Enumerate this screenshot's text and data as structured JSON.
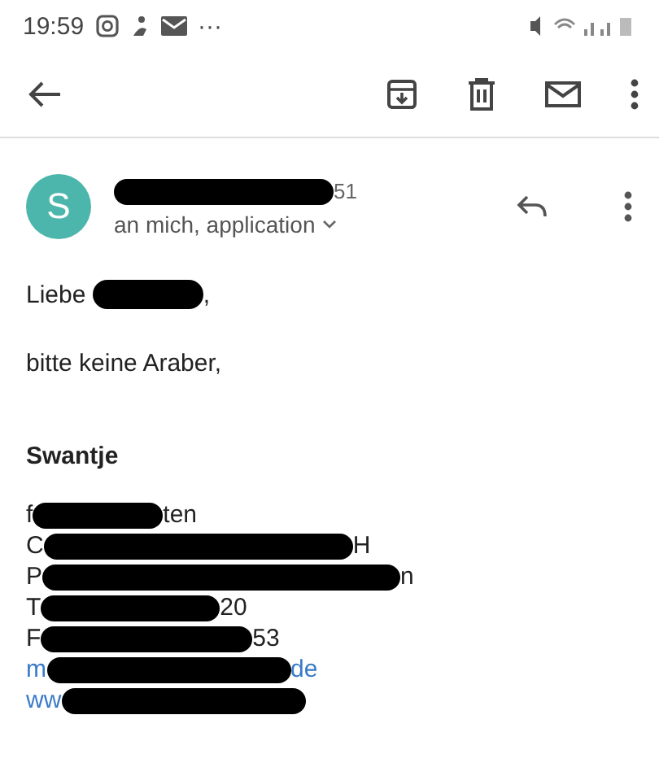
{
  "status_bar": {
    "time": "19:59",
    "more": "···"
  },
  "message": {
    "avatar_letter": "S",
    "sender_tail": "51",
    "recipients": "an mich, application",
    "greeting": "Liebe",
    "greeting_end": ",",
    "body": "bitte keine Araber,",
    "signature_name": "Swantje",
    "signature_lines": [
      {
        "kind": "text",
        "start": "f",
        "end": "ten"
      },
      {
        "kind": "text",
        "start": "C",
        "end": "H"
      },
      {
        "kind": "text",
        "start": "P",
        "end": "n"
      },
      {
        "kind": "text",
        "start": "T",
        "end": "20"
      },
      {
        "kind": "text",
        "start": "F",
        "end": "53"
      },
      {
        "kind": "link",
        "start": "m",
        "end": "de"
      },
      {
        "kind": "link",
        "start": "ww"
      }
    ]
  }
}
